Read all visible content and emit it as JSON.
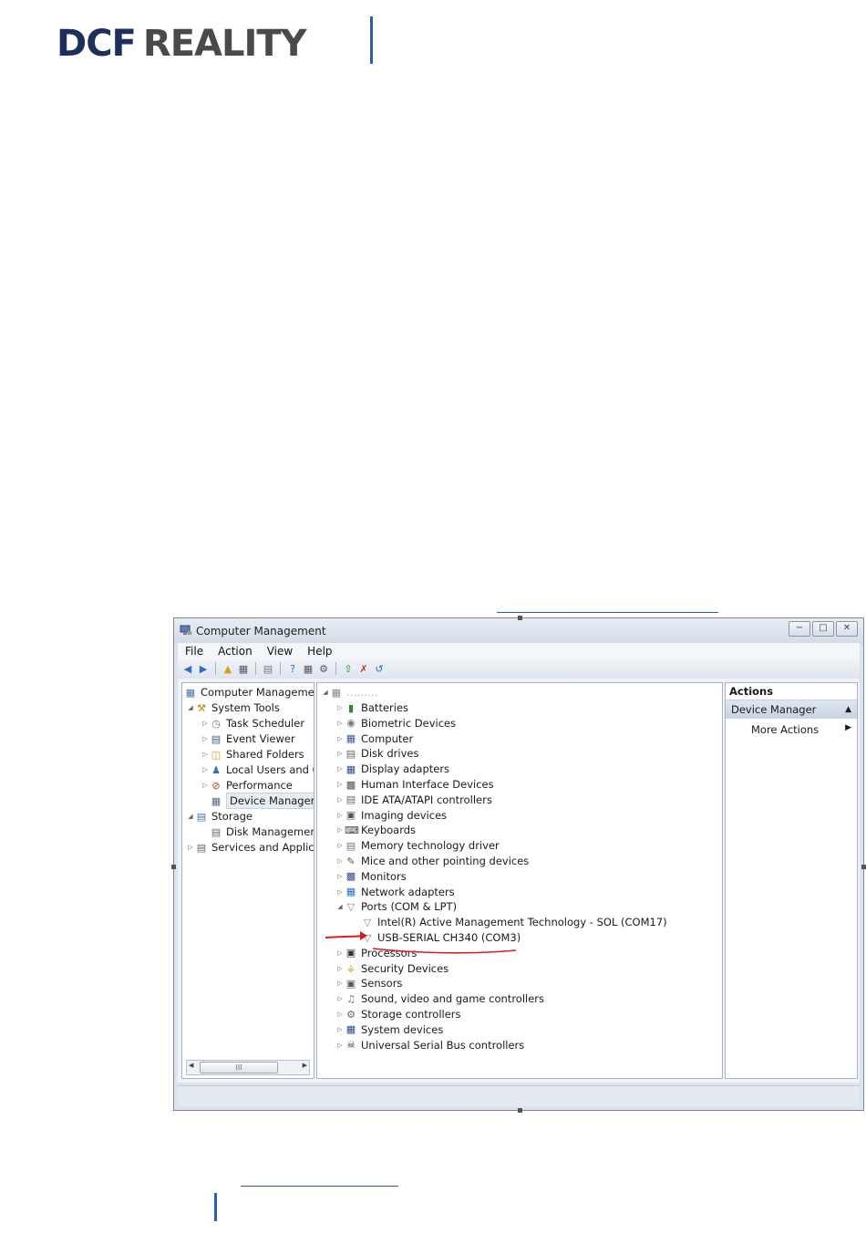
{
  "header": {
    "logo_part1": "DCF",
    "logo_part2": "REALITY"
  },
  "window": {
    "title": "Computer Management",
    "controls": [
      "−",
      "□",
      "✕"
    ]
  },
  "menu": [
    "File",
    "Action",
    "View",
    "Help"
  ],
  "left_tree": {
    "root": "Computer Management",
    "system_tools": "System Tools",
    "task_scheduler": "Task Scheduler",
    "event_viewer": "Event Viewer",
    "shared_folders": "Shared Folders",
    "local_users": "Local Users and G",
    "performance": "Performance",
    "device_manager": "Device Manager",
    "storage": "Storage",
    "disk_management": "Disk Management",
    "services": "Services and Applicat",
    "scroll_thumb": "III"
  },
  "device_tree": {
    "computer_name": "………",
    "categories": [
      {
        "label": "Batteries",
        "icon": "battery-icon"
      },
      {
        "label": "Biometric Devices",
        "icon": "biometric-icon"
      },
      {
        "label": "Computer",
        "icon": "computer-icon"
      },
      {
        "label": "Disk drives",
        "icon": "disk-drive-icon"
      },
      {
        "label": "Display adapters",
        "icon": "display-adapter-icon"
      },
      {
        "label": "Human Interface Devices",
        "icon": "hid-icon"
      },
      {
        "label": "IDE ATA/ATAPI controllers",
        "icon": "ide-controller-icon"
      },
      {
        "label": "Imaging devices",
        "icon": "imaging-icon"
      },
      {
        "label": "Keyboards",
        "icon": "keyboard-icon"
      },
      {
        "label": "Memory technology driver",
        "icon": "memory-icon"
      },
      {
        "label": "Mice and other pointing devices",
        "icon": "mouse-icon"
      },
      {
        "label": "Monitors",
        "icon": "monitor-icon"
      },
      {
        "label": "Network adapters",
        "icon": "network-adapter-icon"
      },
      {
        "label": "Ports (COM & LPT)",
        "icon": "port-icon"
      }
    ],
    "ports_children": [
      "Intel(R) Active Management Technology - SOL (COM17)",
      "USB-SERIAL CH340 (COM3)"
    ],
    "more_categories": [
      {
        "label": "Processors",
        "icon": "processor-icon"
      },
      {
        "label": "Security Devices",
        "icon": "security-icon"
      },
      {
        "label": "Sensors",
        "icon": "sensor-icon"
      },
      {
        "label": "Sound, video and game controllers",
        "icon": "sound-icon"
      },
      {
        "label": "Storage controllers",
        "icon": "storage-controller-icon"
      },
      {
        "label": "System devices",
        "icon": "system-device-icon"
      },
      {
        "label": "Universal Serial Bus controllers",
        "icon": "usb-icon"
      }
    ]
  },
  "actions": {
    "header": "Actions",
    "section": "Device Manager",
    "more": "More Actions"
  },
  "colors": {
    "accent": "#2b5faa",
    "annotation": "#d42020",
    "logo_dark": "#1f2f5c",
    "logo_grey": "#4a4a4a"
  }
}
